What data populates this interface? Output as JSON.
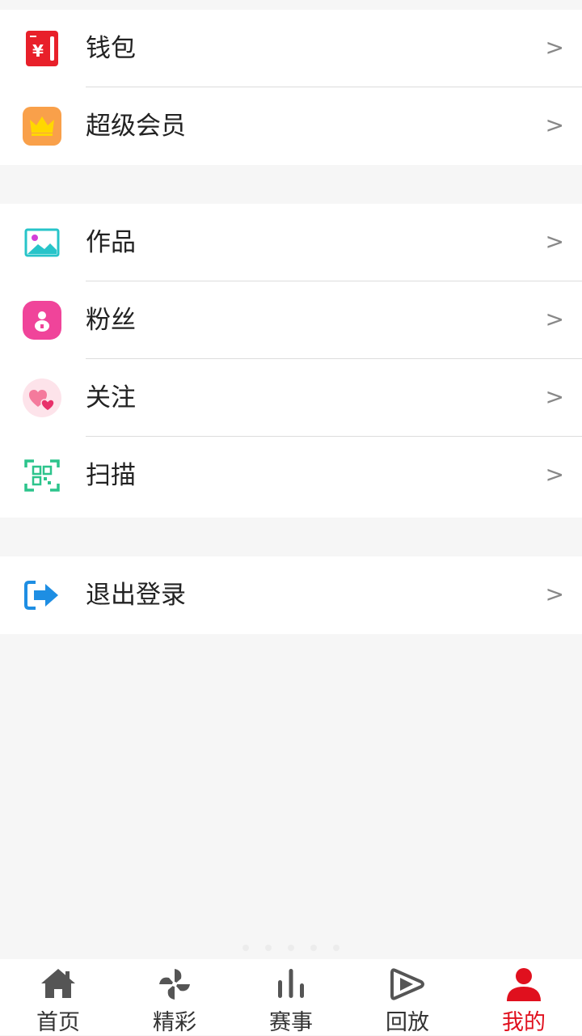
{
  "menu_groups": [
    {
      "items": [
        {
          "label": "钱包",
          "icon": "wallet-icon"
        },
        {
          "label": "超级会员",
          "icon": "crown-icon"
        }
      ]
    },
    {
      "items": [
        {
          "label": "作品",
          "icon": "image-icon"
        },
        {
          "label": "粉丝",
          "icon": "fans-icon"
        },
        {
          "label": "关注",
          "icon": "hearts-icon"
        },
        {
          "label": "扫描",
          "icon": "qr-scan-icon"
        }
      ]
    },
    {
      "items": [
        {
          "label": "退出登录",
          "icon": "logout-icon"
        }
      ]
    }
  ],
  "chevron": ">",
  "tabbar": {
    "tabs": [
      {
        "label": "首页",
        "icon": "home-icon"
      },
      {
        "label": "精彩",
        "icon": "pinwheel-icon"
      },
      {
        "label": "赛事",
        "icon": "bars-icon"
      },
      {
        "label": "回放",
        "icon": "replay-icon"
      },
      {
        "label": "我的",
        "icon": "user-icon",
        "active": true
      }
    ]
  },
  "colors": {
    "active_tab": "#e0101e",
    "wallet": "#e8202a",
    "crown_bg": "#f9a04a",
    "image": "#27c4c9",
    "fans": "#f0449a",
    "hearts": "#f04e7e",
    "qr": "#2cc48c",
    "logout": "#1e8ee3"
  }
}
